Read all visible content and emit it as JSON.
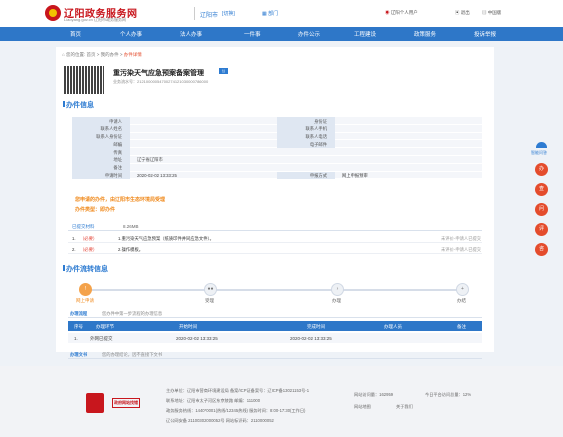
{
  "header": {
    "title": "辽阳政务服务网",
    "subtitle": "Liaoyang.gov.cn 辽阳市政务服务网",
    "city": "辽阳市",
    "switch_label": "[切换]",
    "dept_label": "部门",
    "user_label": "辽阳个人用户",
    "logout_label": "退出",
    "lang_label": "中国版"
  },
  "nav": [
    "首页",
    "个人办事",
    "法人办事",
    "一件事",
    "办件公示",
    "工程建设",
    "政策服务",
    "投诉举报"
  ],
  "breadcrumb": {
    "items": [
      "您的位置:",
      "首页",
      "我的办件",
      "办件详情"
    ]
  },
  "case": {
    "title": "重污染天气应急预案备案管理",
    "tag": "公",
    "number": "业务流水号：21210000054700274121030000786000"
  },
  "sections": {
    "info": "办件信息",
    "flow": "办件流转信息"
  },
  "info_rows": [
    {
      "l1": "申请人",
      "v1": "",
      "l2": "身份证",
      "v2": ""
    },
    {
      "l1": "联系人姓名",
      "v1": "",
      "l2": "联系人手机",
      "v2": ""
    },
    {
      "l1": "联系人身份证",
      "v1": "",
      "l2": "联系人电话",
      "v2": ""
    },
    {
      "l1": "邮编",
      "v1": "",
      "l2": "电子邮件",
      "v2": ""
    },
    {
      "l1": "传真",
      "v1": "",
      "l2": "",
      "v2": ""
    },
    {
      "l1": "地址",
      "v1": "辽宁省辽阳市",
      "l2": "",
      "v2": ""
    },
    {
      "l1": "备注",
      "v1": "",
      "l2": "",
      "v2": ""
    },
    {
      "l1": "申请时间",
      "v1": "2020-02-02 13:33:25",
      "l2": "申报方式",
      "v2": "网上申报预审"
    }
  ],
  "notice": {
    "line1": "您申请的办件，由辽阳市生态环境局受理",
    "line2": "办件类型：即办件"
  },
  "materials": {
    "header": "已提交材料",
    "size": "8.26MB",
    "rows": [
      {
        "no": "1.",
        "req": "（必要）",
        "name": "1.重污染天气应急预案（纸质印件并同应急文件）。",
        "status": "未评价-申请人已提交"
      },
      {
        "no": "2.",
        "req": "（必要）",
        "name": "2.操作模板。",
        "status": "未评价-申请人已提交"
      }
    ]
  },
  "flow": {
    "steps": [
      {
        "icon": "!",
        "label": "网上申请"
      },
      {
        "icon": "●●",
        "label": "受理"
      },
      {
        "icon": "›",
        "label": "办理"
      },
      {
        "icon": "+",
        "label": "办结"
      }
    ]
  },
  "tabs": {
    "active": "办理流程",
    "other": "您办件中第一步流程的办理信息"
  },
  "process_table": {
    "headers": [
      "序号",
      "办理环节",
      "开始时间",
      "完成时间",
      "办理人员",
      "备注"
    ],
    "rows": [
      [
        "1.",
        "外网已提交",
        "2020-02-02 13:33:25",
        "2020-02-02 13:33:25",
        "",
        ""
      ]
    ]
  },
  "result": {
    "label": "办理文书",
    "desc": "您的办理结论，因不直接下文书"
  },
  "side": {
    "title": "智能问答",
    "items": [
      "办",
      "查",
      "问",
      "评",
      "咨"
    ]
  },
  "footer": {
    "badge": "政府网站找错",
    "lines": [
      "主办单位：辽阳市营商环境建设局 备案/ICP证备案号：辽ICP备13021153号-1",
      "联系地址：辽阳市太子河区东京陵路 邮编：111000",
      "政务服务热线：1440*0001(热线/12345热线)  服务时间：8:00-17:30(工作日)",
      "辽公网安备 21100302000052号 网站标识码：2110000052"
    ],
    "stats": [
      "网站访问量：162959",
      "今日平台访问总量：12%",
      "网站地图",
      "关于我们"
    ]
  },
  "colors": {
    "brand": "#2e77c8",
    "red": "#c8161d",
    "accent": "#f08a1d"
  }
}
